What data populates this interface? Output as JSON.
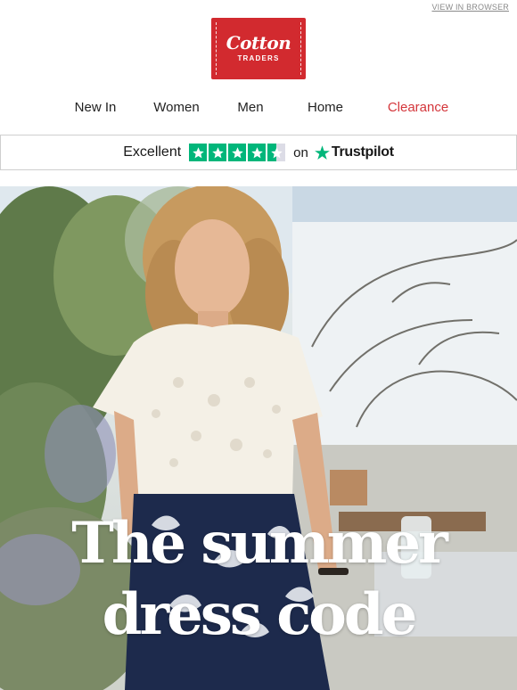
{
  "header": {
    "view_in_browser": "VIEW IN BROWSER",
    "logo": {
      "word": "Cotton",
      "sub": "TRADERS",
      "color": "#d22a2f"
    }
  },
  "nav": {
    "items": [
      {
        "label": "New In"
      },
      {
        "label": "Women"
      },
      {
        "label": "Men"
      },
      {
        "label": "Home"
      },
      {
        "label": "Clearance",
        "color": "#d4363b"
      }
    ]
  },
  "trustpilot": {
    "rating_word": "Excellent",
    "stars_filled": 4.5,
    "stars_total": 5,
    "on_text": "on",
    "brand": "Trustpilot",
    "star_color": "#00b67a"
  },
  "hero": {
    "headline_line1": "The summer",
    "headline_line2": "dress code"
  }
}
